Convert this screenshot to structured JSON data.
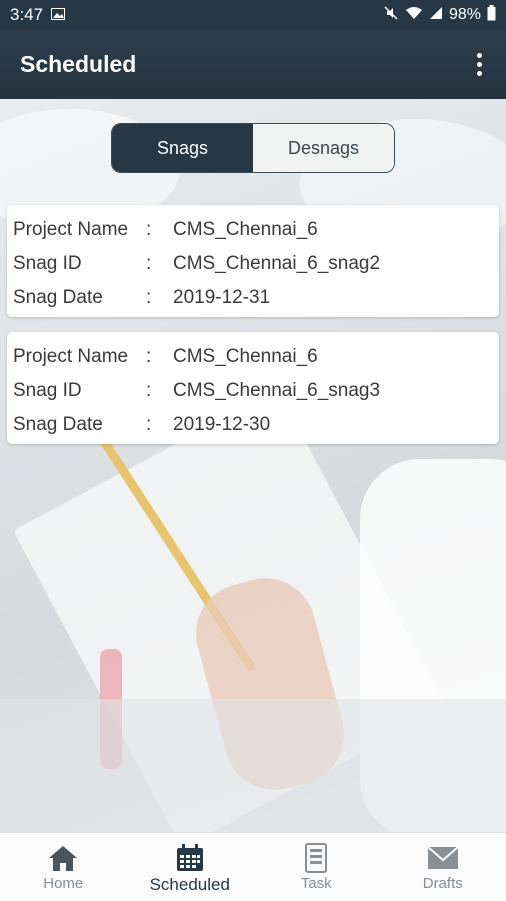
{
  "status_bar": {
    "time": "3:47",
    "battery": "98%",
    "icons": [
      "image-icon",
      "mute-icon",
      "wifi-icon",
      "signal-icon",
      "battery-icon"
    ]
  },
  "app_bar": {
    "title": "Scheduled",
    "menu_icon": "more-vert-icon"
  },
  "segment": {
    "tabs": [
      {
        "label": "Snags",
        "active": true
      },
      {
        "label": "Desnags",
        "active": false
      }
    ]
  },
  "cards": [
    {
      "rows": [
        {
          "label": "Project Name",
          "sep": ":",
          "value": "CMS_Chennai_6"
        },
        {
          "label": "Snag ID",
          "sep": ":",
          "value": "CMS_Chennai_6_snag2"
        },
        {
          "label": "Snag Date",
          "sep": ":",
          "value": "2019-12-31"
        }
      ]
    },
    {
      "rows": [
        {
          "label": "Project Name",
          "sep": ":",
          "value": "CMS_Chennai_6"
        },
        {
          "label": "Snag ID",
          "sep": ":",
          "value": "CMS_Chennai_6_snag3"
        },
        {
          "label": "Snag Date",
          "sep": ":",
          "value": "2019-12-30"
        }
      ]
    }
  ],
  "bottom_nav": {
    "items": [
      {
        "label": "Home",
        "icon": "home-icon",
        "active": false
      },
      {
        "label": "Scheduled",
        "icon": "calendar-icon",
        "active": true
      },
      {
        "label": "Task",
        "icon": "task-icon",
        "active": false
      },
      {
        "label": "Drafts",
        "icon": "mail-icon",
        "active": false
      }
    ]
  },
  "colors": {
    "primary": "#263746",
    "background": "#eef0f2",
    "inactive_text": "#8a8f94"
  }
}
